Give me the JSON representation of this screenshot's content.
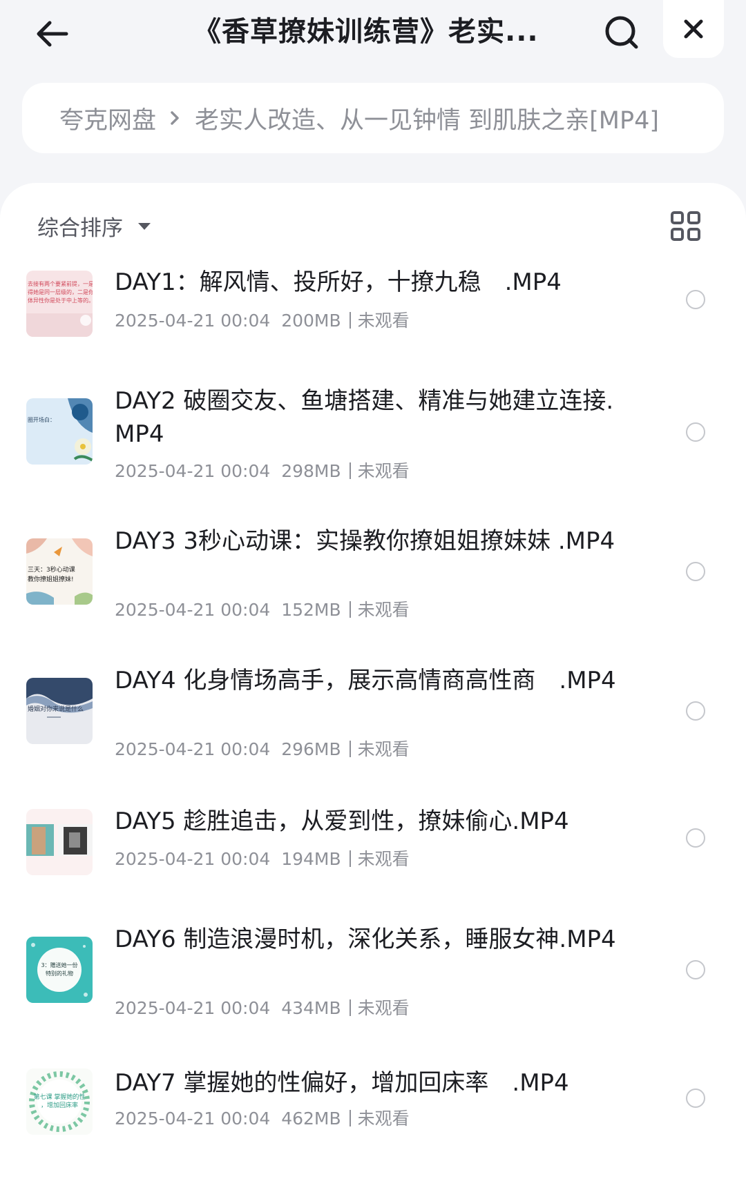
{
  "header": {
    "title": "《香草撩妹训练营》老实...",
    "back_icon": "back-arrow-icon",
    "search_icon": "search-icon",
    "close_icon": "close-icon"
  },
  "breadcrumb": {
    "root": "夸克网盘",
    "separator_icon": "chevron-right-icon",
    "current": "老实人改造、从一见钟情 到肌肤之亲[MP4]"
  },
  "toolbar": {
    "sort_label": "综合排序",
    "sort_icon": "caret-down-icon",
    "view_icon": "grid-view-icon"
  },
  "files": [
    {
      "name": "DAY1：解风情、投所好，十撩九稳　.MP4",
      "date": "2025-04-21 00:04",
      "size": "200MB",
      "status": "未观看",
      "thumb_text": [
        "去接有两个要紧前提，一是你",
        "得她是同一层级的，二是你",
        "体异性你是处于中上等的。"
      ]
    },
    {
      "name": "DAY2 破圈交友、鱼塘搭建、精准与她建立连接.MP4",
      "date": "2025-04-21 00:04",
      "size": "298MB",
      "status": "未观看",
      "thumb_text": [
        "圈开场白："
      ]
    },
    {
      "name": "DAY3 3秒心动课：实操教你撩姐姐撩妹妹 .MP4",
      "date": "2025-04-21 00:04",
      "size": "152MB",
      "status": "未观看",
      "thumb_text": [
        "三天：3秒心动课",
        "教你撩姐姐撩妹!"
      ]
    },
    {
      "name": "DAY4 化身情场高手，展示高情商高性商　.MP4",
      "date": "2025-04-21 00:04",
      "size": "296MB",
      "status": "未观看",
      "thumb_text": [
        "婚姻对你来说是什么"
      ]
    },
    {
      "name": "DAY5 趁胜追击，从爱到性，撩妹偷心.MP4",
      "date": "2025-04-21 00:04",
      "size": "194MB",
      "status": "未观看",
      "thumb_text": []
    },
    {
      "name": "DAY6 制造浪漫时机，深化关系，睡服女神.MP4",
      "date": "2025-04-21 00:04",
      "size": "434MB",
      "status": "未观看",
      "thumb_text": [
        "3：赠送她一份",
        "特别的礼物"
      ]
    },
    {
      "name": "DAY7 掌握她的性偏好，增加回床率　.MP4",
      "date": "2025-04-21 00:04",
      "size": "462MB",
      "status": "未观看",
      "thumb_text": [
        "第七课 掌握她的性",
        "，增加回床率"
      ]
    }
  ]
}
